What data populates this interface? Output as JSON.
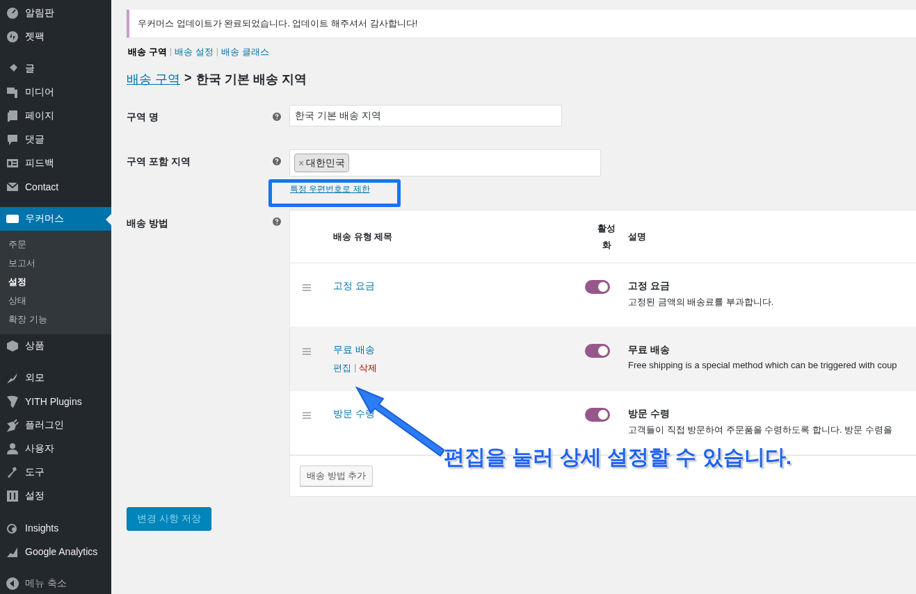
{
  "sidebar": {
    "groups": [
      {
        "items": [
          {
            "label": "알림판",
            "selected": false
          },
          {
            "label": "젯팩",
            "selected": false
          }
        ]
      },
      {
        "items": [
          {
            "label": "글",
            "selected": false
          },
          {
            "label": "미디어",
            "selected": false
          },
          {
            "label": "페이지",
            "selected": false
          },
          {
            "label": "댓글",
            "selected": false
          },
          {
            "label": "피드백",
            "selected": false
          },
          {
            "label": "Contact",
            "selected": false
          }
        ]
      },
      {
        "items": [
          {
            "label": "우커머스",
            "selected": true,
            "children": [
              {
                "label": "주문",
                "selected": false
              },
              {
                "label": "보고서",
                "selected": false
              },
              {
                "label": "설정",
                "selected": true
              },
              {
                "label": "상태",
                "selected": false
              },
              {
                "label": "확장 기능",
                "selected": false
              }
            ]
          },
          {
            "label": "상품",
            "selected": false
          }
        ]
      },
      {
        "items": [
          {
            "label": "외모",
            "selected": false
          },
          {
            "label": "YITH Plugins",
            "selected": false
          },
          {
            "label": "플러그인",
            "selected": false
          },
          {
            "label": "사용자",
            "selected": false
          },
          {
            "label": "도구",
            "selected": false
          },
          {
            "label": "설정",
            "selected": false
          }
        ]
      },
      {
        "items": [
          {
            "label": "Insights",
            "selected": false
          },
          {
            "label": "Google Analytics",
            "selected": false
          }
        ]
      }
    ],
    "collapse_label": "메뉴 축소"
  },
  "notice": "우커머스 업데이트가 완료되었습니다. 업데이트 해주셔서 감사합니다!",
  "tabs": [
    {
      "label": "배송 구역",
      "selected": true
    },
    {
      "separator": "|",
      "label": "배송 설정",
      "selected": false
    },
    {
      "separator": "|",
      "label": "배송 클래스",
      "selected": false
    }
  ],
  "breadcrumb": {
    "link": "배송 구역",
    "separator": ">",
    "current": "한국 기본 배송 지역"
  },
  "form": {
    "zone_name": {
      "label": "구역 명",
      "value": "한국 기본 배송 지역"
    },
    "zone_regions": {
      "label": "구역 포함 지역",
      "tags": [
        {
          "remove": "×",
          "label": "대한민국"
        }
      ],
      "postcode_link": "특정 우편번호로 제한"
    },
    "methods": {
      "label": "배송 방법",
      "columns": [
        "배송 유형 제목",
        "활성화",
        "설명"
      ],
      "rows": [
        {
          "title": "고정 요금",
          "enabled": true,
          "actions": [],
          "description_title": "고정 요금",
          "description": "고정된 금액의 배송료를 부과합니다.",
          "highlighted": false
        },
        {
          "title": "무료 배송",
          "enabled": true,
          "actions": [
            {
              "label": "편집",
              "kind": "edit"
            },
            {
              "separator": "|",
              "label": "삭제",
              "kind": "delete"
            }
          ],
          "description_title": "무료 배송",
          "description": "Free shipping is a special method which can be triggered with coup",
          "highlighted": true
        },
        {
          "title": "방문 수령",
          "enabled": true,
          "actions": [],
          "description_title": "방문 수령",
          "description": "고객들이 직접 방문하여 주문품을 수령하도록 합니다. 방문 수령을",
          "highlighted": false
        }
      ],
      "add_button": "배송 방법 추가"
    }
  },
  "save_button": "변경 사항 저장",
  "annotation": "편집을 눌러 상세 설정할 수 있습니다."
}
